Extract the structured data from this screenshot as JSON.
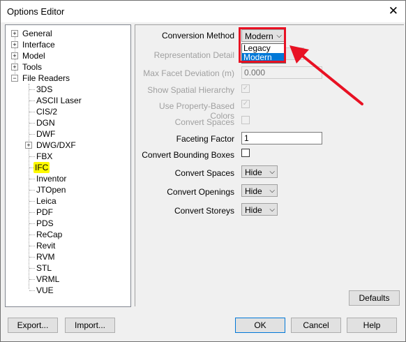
{
  "window": {
    "title": "Options Editor"
  },
  "tree": {
    "top": [
      {
        "label": "General"
      },
      {
        "label": "Interface"
      },
      {
        "label": "Model"
      },
      {
        "label": "Tools"
      },
      {
        "label": "File Readers"
      }
    ],
    "readers": [
      {
        "label": "3DS"
      },
      {
        "label": "ASCII Laser"
      },
      {
        "label": "CIS/2"
      },
      {
        "label": "DGN"
      },
      {
        "label": "DWF"
      },
      {
        "label": "DWG/DXF"
      },
      {
        "label": "FBX"
      },
      {
        "label": "IFC",
        "highlighted": true
      },
      {
        "label": "Inventor"
      },
      {
        "label": "JTOpen"
      },
      {
        "label": "Leica"
      },
      {
        "label": "PDF"
      },
      {
        "label": "PDS"
      },
      {
        "label": "ReCap"
      },
      {
        "label": "Revit"
      },
      {
        "label": "RVM"
      },
      {
        "label": "STL"
      },
      {
        "label": "VRML"
      },
      {
        "label": "VUE"
      }
    ]
  },
  "settings": {
    "conversion_method": {
      "label": "Conversion Method",
      "value": "Modern",
      "options": [
        "Legacy",
        "Modern"
      ]
    },
    "representation_detail": {
      "label": "Representation Detail"
    },
    "max_facet_deviation": {
      "label": "Max Facet Deviation (m)",
      "value": "0.000"
    },
    "show_spatial_hierarchy": {
      "label": "Show Spatial Hierarchy",
      "checked": true
    },
    "use_property_colors": {
      "label": "Use Property-Based Colors",
      "checked": true
    },
    "convert_spaces_chk": {
      "label": "Convert Spaces",
      "checked": false
    },
    "faceting_factor": {
      "label": "Faceting Factor",
      "value": "1"
    },
    "convert_bounding_boxes": {
      "label": "Convert Bounding Boxes",
      "checked": false
    },
    "convert_spaces": {
      "label": "Convert Spaces",
      "value": "Hide"
    },
    "convert_openings": {
      "label": "Convert Openings",
      "value": "Hide"
    },
    "convert_storeys": {
      "label": "Convert Storeys",
      "value": "Hide"
    }
  },
  "buttons": {
    "defaults": "Defaults",
    "export": "Export...",
    "import": "Import...",
    "ok": "OK",
    "cancel": "Cancel",
    "help": "Help"
  },
  "colors": {
    "annotation": "#e81123",
    "selection": "#0078d7",
    "highlight": "#fffa00"
  }
}
